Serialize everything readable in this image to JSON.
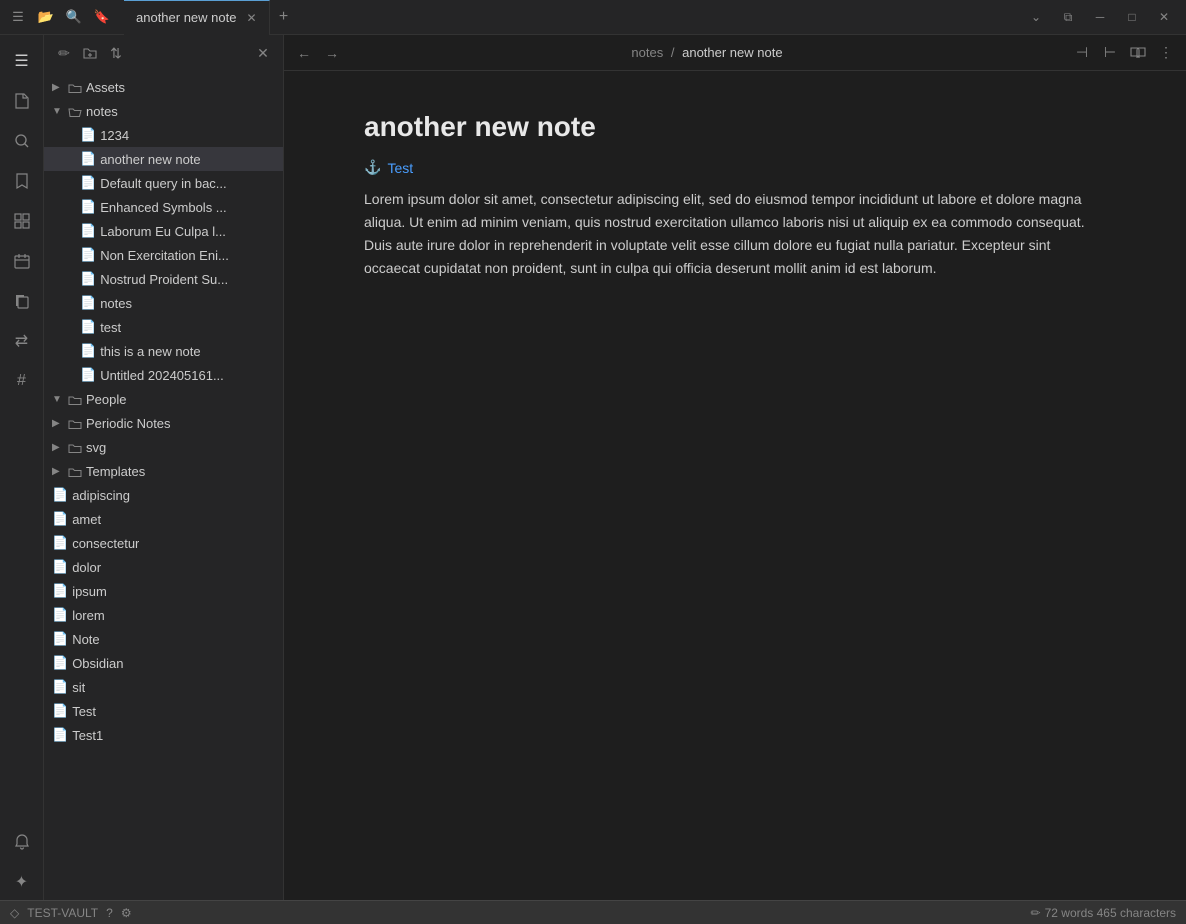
{
  "titleBar": {
    "tab": "another new note",
    "addTab": "+",
    "controls": {
      "dropdown": "⌄",
      "splitEditor": "⧉",
      "minimize": "─",
      "maximize": "□",
      "close": "✕"
    }
  },
  "activityBar": {
    "icons": [
      {
        "name": "sidebar-toggle",
        "glyph": "☰"
      },
      {
        "name": "files",
        "glyph": "📄"
      },
      {
        "name": "search",
        "glyph": "🔍"
      },
      {
        "name": "bookmarks",
        "glyph": "🔖"
      },
      {
        "name": "grid",
        "glyph": "⊞"
      },
      {
        "name": "calendar",
        "glyph": "📅"
      },
      {
        "name": "copy",
        "glyph": "⎘"
      },
      {
        "name": "diff",
        "glyph": "⇄"
      },
      {
        "name": "tag",
        "glyph": "#"
      },
      {
        "name": "bell",
        "glyph": "🔔"
      },
      {
        "name": "star",
        "glyph": "✦"
      }
    ]
  },
  "sidebar": {
    "toolbar": {
      "newNote": "✏",
      "newFolder": "📁",
      "sortAsc": "⇅",
      "close": "✕"
    },
    "tree": {
      "assets": {
        "label": "Assets",
        "collapsed": true
      },
      "notes": {
        "label": "notes",
        "expanded": true,
        "children": [
          {
            "label": "1234",
            "type": "file"
          },
          {
            "label": "another new note",
            "type": "file",
            "selected": true
          },
          {
            "label": "Default query in bac...",
            "type": "file"
          },
          {
            "label": "Enhanced Symbols ...",
            "type": "file"
          },
          {
            "label": "Laborum Eu Culpa l...",
            "type": "file"
          },
          {
            "label": "Non Exercitation Eni...",
            "type": "file"
          },
          {
            "label": "Nostrud Proident Su...",
            "type": "file"
          },
          {
            "label": "notes",
            "type": "file"
          },
          {
            "label": "test",
            "type": "file"
          },
          {
            "label": "this is a new note",
            "type": "file"
          },
          {
            "label": "Untitled 202405161...",
            "type": "file"
          }
        ]
      },
      "people": {
        "label": "People",
        "collapsed": true
      },
      "periodicNotes": {
        "label": "Periodic Notes",
        "collapsed": true
      },
      "svg": {
        "label": "svg",
        "collapsed": true
      },
      "templates": {
        "label": "Templates",
        "collapsed": true
      },
      "rootFiles": [
        {
          "label": "adipiscing"
        },
        {
          "label": "amet"
        },
        {
          "label": "consectetur"
        },
        {
          "label": "dolor"
        },
        {
          "label": "ipsum"
        },
        {
          "label": "lorem"
        },
        {
          "label": "Note"
        },
        {
          "label": "Obsidian"
        },
        {
          "label": "sit"
        },
        {
          "label": "Test"
        },
        {
          "label": "Test1"
        }
      ]
    }
  },
  "editor": {
    "nav": {
      "back": "←",
      "forward": "→",
      "breadcrumb": {
        "parent": "notes",
        "separator": "/",
        "current": "another new note"
      },
      "firstPage": "⊣",
      "lastPage": "⊢",
      "reading": "📖",
      "more": "⋮"
    },
    "document": {
      "title": "another new note",
      "linkAnchor": "⚓",
      "linkLabel": "Test",
      "body": "Lorem ipsum dolor sit amet, consectetur adipiscing elit, sed do eiusmod tempor incididunt ut labore et dolore magna aliqua. Ut enim ad minim veniam, quis nostrud exercitation ullamco laboris nisi ut aliquip ex ea commodo consequat. Duis aute irure dolor in reprehenderit in voluptate velit esse cillum dolore eu fugiat nulla pariatur. Excepteur sint occaecat cupidatat non proident, sunt in culpa qui officia deserunt mollit anim id est laborum."
    }
  },
  "statusBar": {
    "vaultIcon": "◇",
    "vaultName": "TEST-VAULT",
    "helpIcon": "?",
    "settingsIcon": "⚙",
    "editIcon": "✏",
    "wordCount": "72 words 465 characters"
  }
}
